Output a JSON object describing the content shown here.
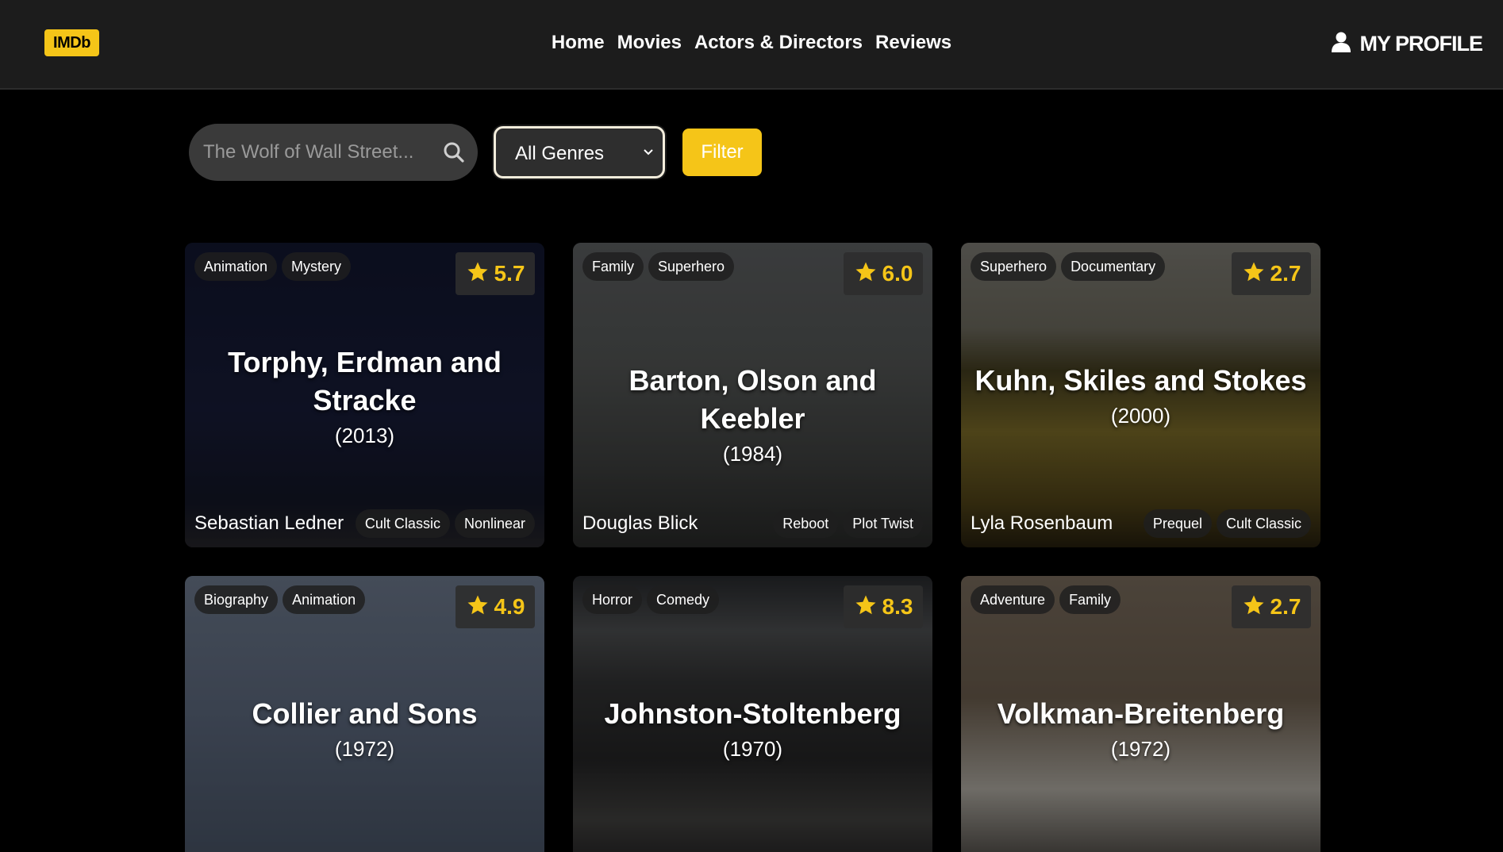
{
  "header": {
    "logo": "IMDb",
    "nav": [
      "Home",
      "Movies",
      "Actors & Directors",
      "Reviews"
    ],
    "profile": "MY PROFILE",
    "profile_icon": "user-icon"
  },
  "search": {
    "placeholder": "The Wolf of Wall Street...",
    "icon": "search-icon"
  },
  "genre_select": {
    "selected": "All Genres",
    "icon": "chevron-down-icon"
  },
  "filter_button": "Filter",
  "colors": {
    "accent": "#f5c518",
    "background": "#000000",
    "header": "#1c1c1c"
  },
  "movies": [
    {
      "genres": [
        "Animation",
        "Mystery"
      ],
      "rating": "5.7",
      "title": "Torphy, Erdman and Stracke",
      "year": "(2013)",
      "director": "Sebastian Ledner",
      "keywords": [
        "Cult Classic",
        "Nonlinear"
      ]
    },
    {
      "genres": [
        "Family",
        "Superhero"
      ],
      "rating": "6.0",
      "title": "Barton, Olson and Keebler",
      "year": "(1984)",
      "director": "Douglas Blick",
      "keywords": [
        "Reboot",
        "Plot Twist"
      ]
    },
    {
      "genres": [
        "Superhero",
        "Documentary"
      ],
      "rating": "2.7",
      "title": "Kuhn, Skiles and Stokes",
      "year": "(2000)",
      "director": "Lyla Rosenbaum",
      "keywords": [
        "Prequel",
        "Cult Classic"
      ]
    },
    {
      "genres": [
        "Biography",
        "Animation"
      ],
      "rating": "4.9",
      "title": "Collier and Sons",
      "year": "(1972)",
      "director": "",
      "keywords": []
    },
    {
      "genres": [
        "Horror",
        "Comedy"
      ],
      "rating": "8.3",
      "title": "Johnston-Stoltenberg",
      "year": "(1970)",
      "director": "",
      "keywords": []
    },
    {
      "genres": [
        "Adventure",
        "Family"
      ],
      "rating": "2.7",
      "title": "Volkman-Breitenberg",
      "year": "(1972)",
      "director": "",
      "keywords": []
    }
  ]
}
